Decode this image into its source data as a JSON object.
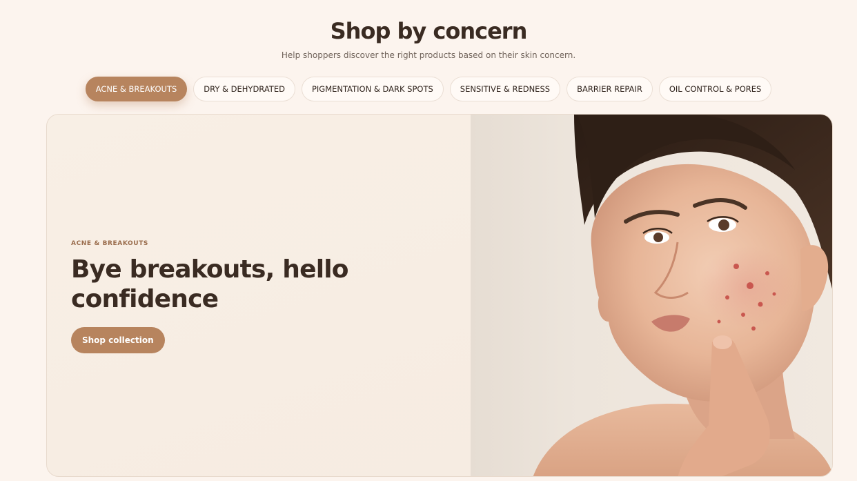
{
  "section": {
    "title": "Shop by concern",
    "subtitle": "Help shoppers discover the right products based on their skin concern."
  },
  "tabs": [
    {
      "label": "ACNE & BREAKOUTS",
      "active": true
    },
    {
      "label": "DRY & DEHYDRATED",
      "active": false
    },
    {
      "label": "PIGMENTATION & DARK SPOTS",
      "active": false
    },
    {
      "label": "SENSITIVE & REDNESS",
      "active": false
    },
    {
      "label": "BARRIER REPAIR",
      "active": false
    },
    {
      "label": "OIL CONTROL & PORES",
      "active": false
    }
  ],
  "feature": {
    "eyebrow": "ACNE & BREAKOUTS",
    "headline": "Bye breakouts, hello confidence",
    "cta_label": "Shop collection",
    "image_subject": "woman-touching-cheek-with-acne-photo"
  },
  "colors": {
    "background": "#fcf4ee",
    "accent": "#b7845e",
    "heading": "#3a2b22",
    "card_bg": "#f7ede3"
  }
}
